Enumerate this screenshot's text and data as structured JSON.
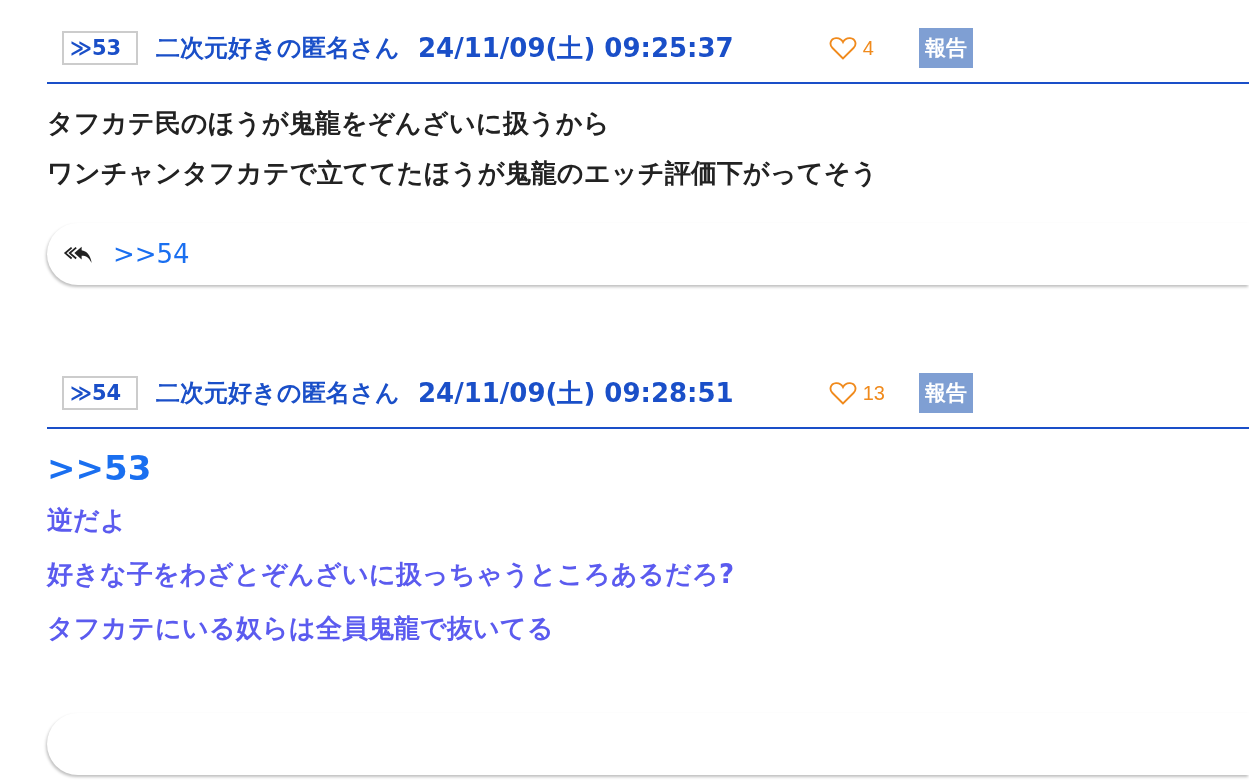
{
  "posts": [
    {
      "number": "≫53",
      "name": "二次元好きの匿名さん",
      "date": "24/11/09(土) 09:25:37",
      "likes": "4",
      "report": "報告",
      "color": "#222222",
      "lines": [
        {
          "kind": "text",
          "text": "タフカテ民のほうが鬼龍をぞんざいに扱うから"
        },
        {
          "kind": "text",
          "text": "ワンチャンタフカテで立ててたほうが鬼龍のエッチ評価下がってそう"
        }
      ],
      "replies": [
        ">>54"
      ]
    },
    {
      "number": "≫54",
      "name": "二次元好きの匿名さん",
      "date": "24/11/09(土) 09:28:51",
      "likes": "13",
      "report": "報告",
      "color": "#5b5bef",
      "lines": [
        {
          "kind": "anchor",
          "text": ">>53"
        },
        {
          "kind": "text",
          "text": "逆だよ"
        },
        {
          "kind": "text",
          "text": "好きな子をわざとぞんざいに扱っちゃうところあるだろ?"
        },
        {
          "kind": "text",
          "text": "タフカテにいる奴らは全員鬼龍で抜いてる"
        }
      ]
    }
  ]
}
